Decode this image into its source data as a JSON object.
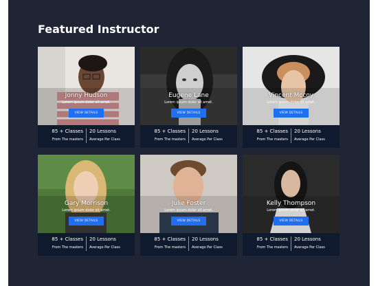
{
  "section": {
    "title": "Featured Instructor"
  },
  "instructors": [
    {
      "name": "Jonny Hudson",
      "description": "Lorem ipsum dolor sit amet.",
      "button_label": "VIEW DETAILS",
      "classes": "85 + Classes",
      "classes_sub": "From The masters",
      "lessons": "20 Lessons",
      "lessons_sub": "Average Per Class"
    },
    {
      "name": "Eugene Lane",
      "description": "Lorem ipsum dolor sit amet.",
      "button_label": "VIEW DETAILS",
      "classes": "85 + Classes",
      "classes_sub": "From The masters",
      "lessons": "20 Lessons",
      "lessons_sub": "Average Per Class"
    },
    {
      "name": "Vincent Mccoy",
      "description": "Lorem ipsum dolor sit amet.",
      "button_label": "VIEW DETAILS",
      "classes": "85 + Classes",
      "classes_sub": "From The masters",
      "lessons": "20 Lessons",
      "lessons_sub": "Average Per Class"
    },
    {
      "name": "Gary Morrison",
      "description": "Lorem ipsum dolor sit amet.",
      "button_label": "VIEW DETAILS",
      "classes": "85 + Classes",
      "classes_sub": "From The masters",
      "lessons": "20 Lessons",
      "lessons_sub": "Average Per Class"
    },
    {
      "name": "Julie Foster",
      "description": "Lorem ipsum dolor sit amet.",
      "button_label": "VIEW DETAILS",
      "classes": "85 + Classes",
      "classes_sub": "From The masters",
      "lessons": "20 Lessons",
      "lessons_sub": "Average Per Class"
    },
    {
      "name": "Kelly Thompson",
      "description": "Lorem ipsum dolor sit amet.",
      "button_label": "VIEW DETAILS",
      "classes": "85 + Classes",
      "classes_sub": "From The masters",
      "lessons": "20 Lessons",
      "lessons_sub": "Average Per Class"
    }
  ],
  "colors": {
    "background": "#1f2535",
    "card": "#0f1a2e",
    "button": "#1f6ff0",
    "text": "#ffffff"
  }
}
